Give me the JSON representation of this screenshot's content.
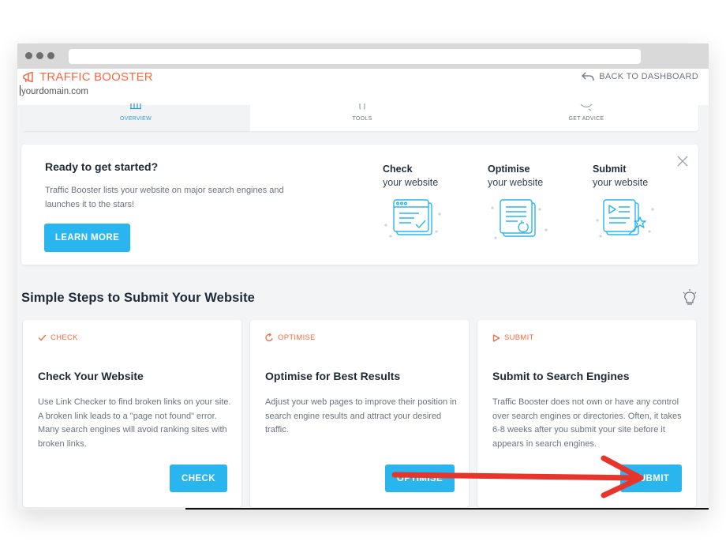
{
  "app": {
    "brand": "TRAFFIC BOOSTER",
    "domain": "yourdomain.com",
    "back_label": "BACK TO DASHBOARD"
  },
  "tabs": [
    {
      "label": "OVERVIEW",
      "icon": "chart-icon",
      "active": true
    },
    {
      "label": "TOOLS",
      "icon": "tools-icon",
      "active": false
    },
    {
      "label": "GET ADVICE",
      "icon": "advice-icon",
      "active": false
    }
  ],
  "promo": {
    "title": "Ready to get started?",
    "description": "Traffic Booster lists your website on major search engines and launches it to the stars!",
    "button_label": "LEARN MORE",
    "steps": [
      {
        "title": "Check",
        "subtitle": "your website",
        "icon": "check-website-illustration"
      },
      {
        "title": "Optimise",
        "subtitle": "your website",
        "icon": "optimise-website-illustration"
      },
      {
        "title": "Submit",
        "subtitle": "your website",
        "icon": "submit-website-illustration"
      }
    ]
  },
  "section": {
    "title": "Simple Steps to Submit Your Website"
  },
  "cards": [
    {
      "tag": "CHECK",
      "title": "Check Your Website",
      "text": "Use Link Checker to find broken links on your site. A broken link leads to a \"page not found\" error. Many search engines will avoid ranking sites with broken links.",
      "button": "CHECK"
    },
    {
      "tag": "OPTIMISE",
      "title": "Optimise for Best Results",
      "text": "Adjust your web pages to improve their position in search engine results and attract your desired traffic.",
      "button": "OPTIMISE"
    },
    {
      "tag": "SUBMIT",
      "title": "Submit to Search Engines",
      "text": "Traffic Booster does not own or have any control over search engines or directories. Often, it takes 6-8 weeks after you submit your site before it appears in search engines.",
      "button": "SUBMIT"
    }
  ],
  "colors": {
    "accent": "#29b6ef",
    "brand": "#f26b42",
    "annotation_arrow": "#e8342a"
  }
}
